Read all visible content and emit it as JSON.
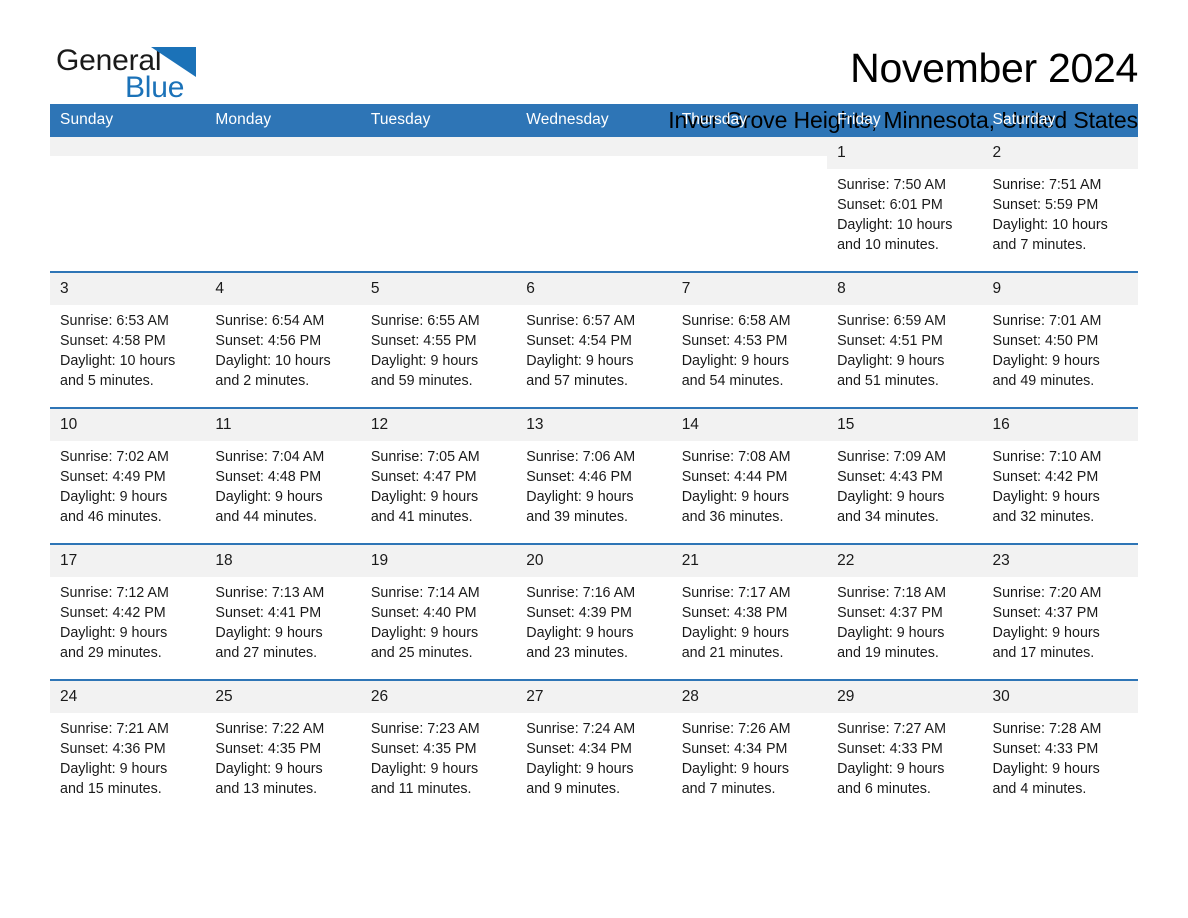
{
  "logo": {
    "word_one": "General",
    "word_two": "Blue",
    "triangle_color": "#1b72b8"
  },
  "header": {
    "month_title": "November 2024",
    "location": "Inver Grove Heights, Minnesota, United States",
    "header_bg_color": "#2e75b6",
    "row_rule_color": "#2e75b6",
    "daynum_bg_color": "#f2f2f2"
  },
  "weekday_headers": [
    "Sunday",
    "Monday",
    "Tuesday",
    "Wednesday",
    "Thursday",
    "Friday",
    "Saturday"
  ],
  "weeks": [
    {
      "days": [
        {
          "num": "",
          "lines": []
        },
        {
          "num": "",
          "lines": []
        },
        {
          "num": "",
          "lines": []
        },
        {
          "num": "",
          "lines": []
        },
        {
          "num": "",
          "lines": []
        },
        {
          "num": "1",
          "lines": [
            "Sunrise: 7:50 AM",
            "Sunset: 6:01 PM",
            "Daylight: 10 hours",
            "and 10 minutes."
          ]
        },
        {
          "num": "2",
          "lines": [
            "Sunrise: 7:51 AM",
            "Sunset: 5:59 PM",
            "Daylight: 10 hours",
            "and 7 minutes."
          ]
        }
      ]
    },
    {
      "days": [
        {
          "num": "3",
          "lines": [
            "Sunrise: 6:53 AM",
            "Sunset: 4:58 PM",
            "Daylight: 10 hours",
            "and 5 minutes."
          ]
        },
        {
          "num": "4",
          "lines": [
            "Sunrise: 6:54 AM",
            "Sunset: 4:56 PM",
            "Daylight: 10 hours",
            "and 2 minutes."
          ]
        },
        {
          "num": "5",
          "lines": [
            "Sunrise: 6:55 AM",
            "Sunset: 4:55 PM",
            "Daylight: 9 hours",
            "and 59 minutes."
          ]
        },
        {
          "num": "6",
          "lines": [
            "Sunrise: 6:57 AM",
            "Sunset: 4:54 PM",
            "Daylight: 9 hours",
            "and 57 minutes."
          ]
        },
        {
          "num": "7",
          "lines": [
            "Sunrise: 6:58 AM",
            "Sunset: 4:53 PM",
            "Daylight: 9 hours",
            "and 54 minutes."
          ]
        },
        {
          "num": "8",
          "lines": [
            "Sunrise: 6:59 AM",
            "Sunset: 4:51 PM",
            "Daylight: 9 hours",
            "and 51 minutes."
          ]
        },
        {
          "num": "9",
          "lines": [
            "Sunrise: 7:01 AM",
            "Sunset: 4:50 PM",
            "Daylight: 9 hours",
            "and 49 minutes."
          ]
        }
      ]
    },
    {
      "days": [
        {
          "num": "10",
          "lines": [
            "Sunrise: 7:02 AM",
            "Sunset: 4:49 PM",
            "Daylight: 9 hours",
            "and 46 minutes."
          ]
        },
        {
          "num": "11",
          "lines": [
            "Sunrise: 7:04 AM",
            "Sunset: 4:48 PM",
            "Daylight: 9 hours",
            "and 44 minutes."
          ]
        },
        {
          "num": "12",
          "lines": [
            "Sunrise: 7:05 AM",
            "Sunset: 4:47 PM",
            "Daylight: 9 hours",
            "and 41 minutes."
          ]
        },
        {
          "num": "13",
          "lines": [
            "Sunrise: 7:06 AM",
            "Sunset: 4:46 PM",
            "Daylight: 9 hours",
            "and 39 minutes."
          ]
        },
        {
          "num": "14",
          "lines": [
            "Sunrise: 7:08 AM",
            "Sunset: 4:44 PM",
            "Daylight: 9 hours",
            "and 36 minutes."
          ]
        },
        {
          "num": "15",
          "lines": [
            "Sunrise: 7:09 AM",
            "Sunset: 4:43 PM",
            "Daylight: 9 hours",
            "and 34 minutes."
          ]
        },
        {
          "num": "16",
          "lines": [
            "Sunrise: 7:10 AM",
            "Sunset: 4:42 PM",
            "Daylight: 9 hours",
            "and 32 minutes."
          ]
        }
      ]
    },
    {
      "days": [
        {
          "num": "17",
          "lines": [
            "Sunrise: 7:12 AM",
            "Sunset: 4:42 PM",
            "Daylight: 9 hours",
            "and 29 minutes."
          ]
        },
        {
          "num": "18",
          "lines": [
            "Sunrise: 7:13 AM",
            "Sunset: 4:41 PM",
            "Daylight: 9 hours",
            "and 27 minutes."
          ]
        },
        {
          "num": "19",
          "lines": [
            "Sunrise: 7:14 AM",
            "Sunset: 4:40 PM",
            "Daylight: 9 hours",
            "and 25 minutes."
          ]
        },
        {
          "num": "20",
          "lines": [
            "Sunrise: 7:16 AM",
            "Sunset: 4:39 PM",
            "Daylight: 9 hours",
            "and 23 minutes."
          ]
        },
        {
          "num": "21",
          "lines": [
            "Sunrise: 7:17 AM",
            "Sunset: 4:38 PM",
            "Daylight: 9 hours",
            "and 21 minutes."
          ]
        },
        {
          "num": "22",
          "lines": [
            "Sunrise: 7:18 AM",
            "Sunset: 4:37 PM",
            "Daylight: 9 hours",
            "and 19 minutes."
          ]
        },
        {
          "num": "23",
          "lines": [
            "Sunrise: 7:20 AM",
            "Sunset: 4:37 PM",
            "Daylight: 9 hours",
            "and 17 minutes."
          ]
        }
      ]
    },
    {
      "days": [
        {
          "num": "24",
          "lines": [
            "Sunrise: 7:21 AM",
            "Sunset: 4:36 PM",
            "Daylight: 9 hours",
            "and 15 minutes."
          ]
        },
        {
          "num": "25",
          "lines": [
            "Sunrise: 7:22 AM",
            "Sunset: 4:35 PM",
            "Daylight: 9 hours",
            "and 13 minutes."
          ]
        },
        {
          "num": "26",
          "lines": [
            "Sunrise: 7:23 AM",
            "Sunset: 4:35 PM",
            "Daylight: 9 hours",
            "and 11 minutes."
          ]
        },
        {
          "num": "27",
          "lines": [
            "Sunrise: 7:24 AM",
            "Sunset: 4:34 PM",
            "Daylight: 9 hours",
            "and 9 minutes."
          ]
        },
        {
          "num": "28",
          "lines": [
            "Sunrise: 7:26 AM",
            "Sunset: 4:34 PM",
            "Daylight: 9 hours",
            "and 7 minutes."
          ]
        },
        {
          "num": "29",
          "lines": [
            "Sunrise: 7:27 AM",
            "Sunset: 4:33 PM",
            "Daylight: 9 hours",
            "and 6 minutes."
          ]
        },
        {
          "num": "30",
          "lines": [
            "Sunrise: 7:28 AM",
            "Sunset: 4:33 PM",
            "Daylight: 9 hours",
            "and 4 minutes."
          ]
        }
      ]
    }
  ]
}
